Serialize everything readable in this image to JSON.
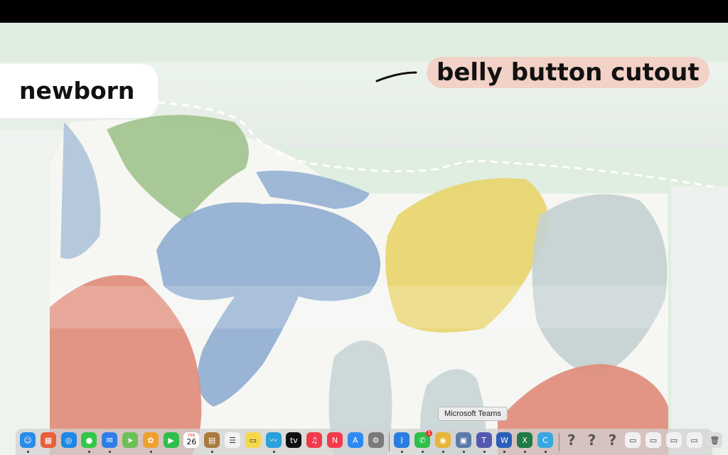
{
  "overlay": {
    "size_label": "newborn",
    "feature_label": "belly button cutout"
  },
  "tooltip": {
    "text": "Microsoft Teams"
  },
  "dock": {
    "apps": [
      {
        "name": "finder-icon",
        "color": "#2a8be8",
        "glyph": "☺"
      },
      {
        "name": "launchpad-icon",
        "color": "#e8603a",
        "glyph": "▦"
      },
      {
        "name": "safari-icon",
        "color": "#1e88e5",
        "glyph": "◎"
      },
      {
        "name": "messages-icon",
        "color": "#33c748",
        "glyph": "●"
      },
      {
        "name": "mail-icon",
        "color": "#2f7ee8",
        "glyph": "✉"
      },
      {
        "name": "maps-icon",
        "color": "#6dbf5a",
        "glyph": "➤"
      },
      {
        "name": "photos-icon",
        "color": "#f0a030",
        "glyph": "✿"
      },
      {
        "name": "facetime-icon",
        "color": "#2fbf4a",
        "glyph": "▶"
      },
      {
        "name": "calendar-icon",
        "color": "#ffffff",
        "glyph": "",
        "month": "FEB",
        "day": "26"
      },
      {
        "name": "notes-brown-icon",
        "color": "#a87b3d",
        "glyph": "▤"
      },
      {
        "name": "reminders-icon",
        "color": "#f2f2f2",
        "glyph": "☰"
      },
      {
        "name": "notes-icon",
        "color": "#f5d84a",
        "glyph": "▭"
      },
      {
        "name": "freeform-icon",
        "color": "#2aa1d8",
        "glyph": "〰"
      },
      {
        "name": "apple-tv-icon",
        "color": "#111111",
        "glyph": "tv"
      },
      {
        "name": "music-icon",
        "color": "#f03a4a",
        "glyph": "♫"
      },
      {
        "name": "news-icon",
        "color": "#f23a4a",
        "glyph": "N"
      },
      {
        "name": "app-store-icon",
        "color": "#2f8af0",
        "glyph": "A"
      },
      {
        "name": "system-settings-icon",
        "color": "#7a7a7a",
        "glyph": "⚙"
      },
      {
        "name": "bluetooth-icon",
        "color": "#2a7de0",
        "glyph": "ᛒ"
      },
      {
        "name": "whatsapp-icon",
        "color": "#2fbf4a",
        "glyph": "✆",
        "badge": "1"
      },
      {
        "name": "chrome-icon",
        "color": "#e8b43a",
        "glyph": "◉"
      },
      {
        "name": "preview-icon",
        "color": "#5a7aa8",
        "glyph": "▣"
      },
      {
        "name": "microsoft-teams-icon",
        "color": "#5558af",
        "glyph": "T"
      },
      {
        "name": "microsoft-word-icon",
        "color": "#2b5fb8",
        "glyph": "W"
      },
      {
        "name": "microsoft-excel-icon",
        "color": "#1f7a43",
        "glyph": "X"
      },
      {
        "name": "canva-icon",
        "color": "#3aa8e0",
        "glyph": "C"
      },
      {
        "name": "unknown-app-icon-1",
        "color": "transparent",
        "glyph": "?"
      },
      {
        "name": "unknown-app-icon-2",
        "color": "transparent",
        "glyph": "?"
      },
      {
        "name": "unknown-app-icon-3",
        "color": "transparent",
        "glyph": "?"
      },
      {
        "name": "window-thumbnail-1",
        "color": "#f0f0f0",
        "glyph": "▭"
      },
      {
        "name": "window-thumbnail-2",
        "color": "#f0f0f0",
        "glyph": "▭"
      },
      {
        "name": "window-thumbnail-3",
        "color": "#f0f0f0",
        "glyph": "▭"
      },
      {
        "name": "window-thumbnail-4",
        "color": "#f0f0f0",
        "glyph": "▭"
      },
      {
        "name": "trash-icon",
        "color": "#dcdcdc",
        "glyph": "🗑"
      }
    ]
  }
}
